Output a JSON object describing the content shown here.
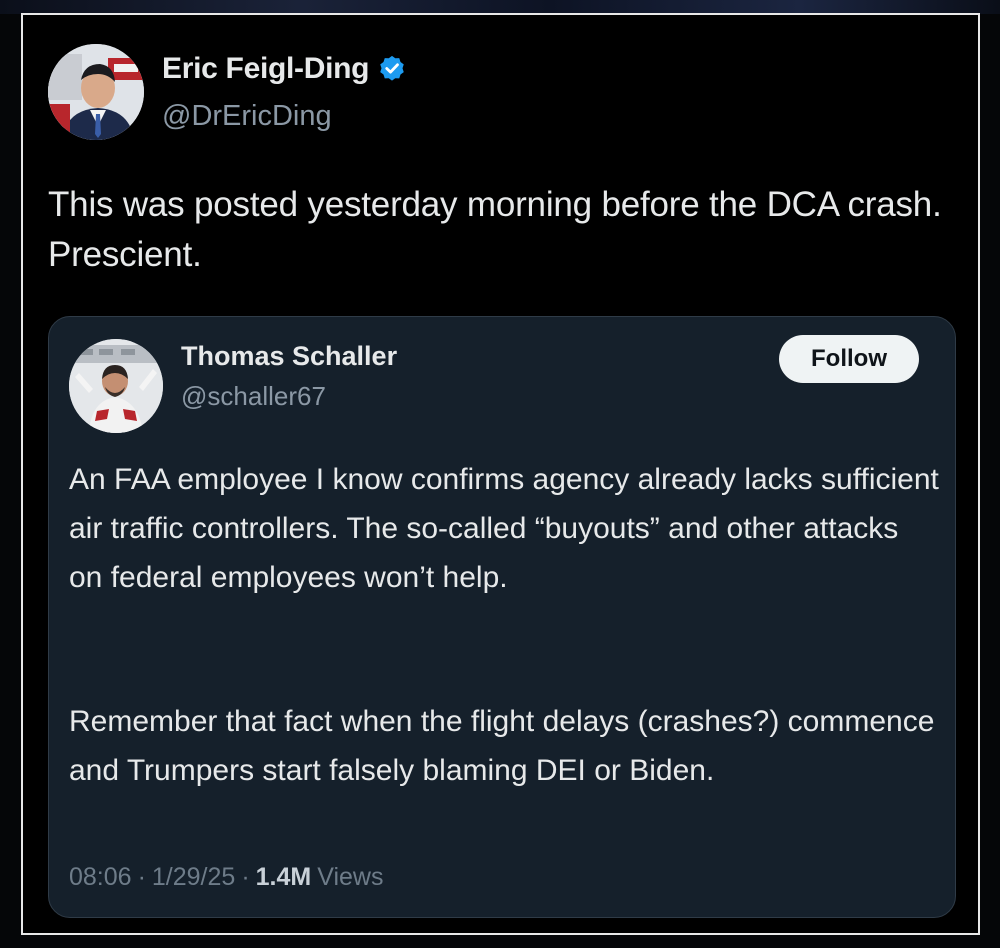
{
  "tweet": {
    "author": {
      "name": "Eric Feigl-Ding",
      "handle": "@DrEricDing",
      "verified_icon": "verified-badge-icon",
      "verified_color": "#1d9bf0"
    },
    "text": "This was posted yesterday morning before the DCA crash. Prescient."
  },
  "quoted_tweet": {
    "author": {
      "name": "Thomas Schaller",
      "handle": "@schaller67"
    },
    "follow_label": "Follow",
    "paragraphs": [
      "An FAA employee I know confirms agency already lacks sufficient air traffic controllers. The so-called “buyouts” and other attacks on federal employees won’t help.",
      "Remember that fact when the flight delays (crashes?) commence and Trumpers start falsely blaming DEI or Biden."
    ],
    "meta": {
      "time": "08:06",
      "separator": "·",
      "date": "1/29/25",
      "views_count": "1.4M",
      "views_label": "Views"
    }
  },
  "colors": {
    "background": "#000000",
    "quote_card_bg": "#15202b",
    "text_primary": "#e7e9ea",
    "text_secondary": "#8b98a5",
    "accent_verified": "#1d9bf0"
  }
}
